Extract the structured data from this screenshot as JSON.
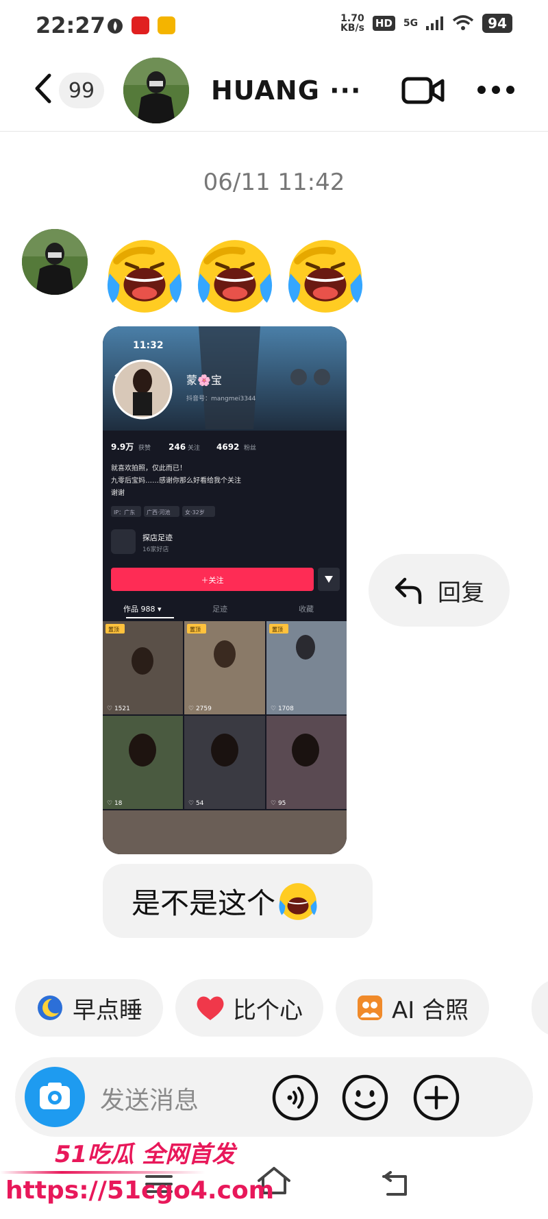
{
  "status_bar": {
    "time": "22:27",
    "net_speed_value": "1.70",
    "net_speed_unit": "KB/s",
    "hd_badge": "HD",
    "network": "5G",
    "battery": "94"
  },
  "header": {
    "back_count": "99",
    "contact_name": "HUANG ···",
    "video_icon": "video-camera-icon",
    "more_icon": "more-dots-icon"
  },
  "messages": {
    "timestamp": "06/11 11:42",
    "emoji_count": 3,
    "emoji_icon": "laughing-crying-emoji",
    "reply_label": "回复",
    "text_message": "是不是这个"
  },
  "shared_screenshot": {
    "time": "11:32",
    "profile_name": "蒙🌸宝",
    "douyin_id": "抖音号：mangmei3344",
    "stats": [
      {
        "value": "9.9万",
        "label": "获赞"
      },
      {
        "value": "246",
        "label": "关注"
      },
      {
        "value": "4692",
        "label": "粉丝"
      }
    ],
    "bio_line1": "就喜欢拍照，仅此而已！",
    "bio_line2": "九零后宝妈……感谢你那么好看给我个关注",
    "bio_line3": "谢谢",
    "tags": [
      "IP：广东",
      "广西·河池",
      "女·32岁"
    ],
    "shop_title": "探店足迹",
    "shop_sub": "16家好店",
    "follow_label": "＋关注",
    "tabs": [
      "作品 988 ▾",
      "足迹",
      "收藏"
    ],
    "pinned_label": "置顶",
    "video_likes": [
      "1521",
      "2759",
      "1708",
      "18",
      "54",
      "95"
    ]
  },
  "quick_chips": [
    {
      "label": "早点睡",
      "icon": "moon-sleep-icon"
    },
    {
      "label": "比个心",
      "icon": "heart-icon"
    },
    {
      "label": "AI 合照",
      "icon": "ai-photo-icon"
    }
  ],
  "input_bar": {
    "placeholder": "发送消息",
    "camera_icon": "camera-icon",
    "voice_icon": "voice-icon",
    "emoji_icon": "smiley-icon",
    "plus_icon": "plus-icon"
  },
  "watermark": {
    "top_text": "51吃瓜 全网首发",
    "url": "https://51cgo4.com"
  },
  "colors": {
    "accent_blue": "#1e9bf0",
    "follow_red": "#fe2c55",
    "watermark_pink": "#e8185a",
    "bubble_gray": "#f2f2f2"
  }
}
